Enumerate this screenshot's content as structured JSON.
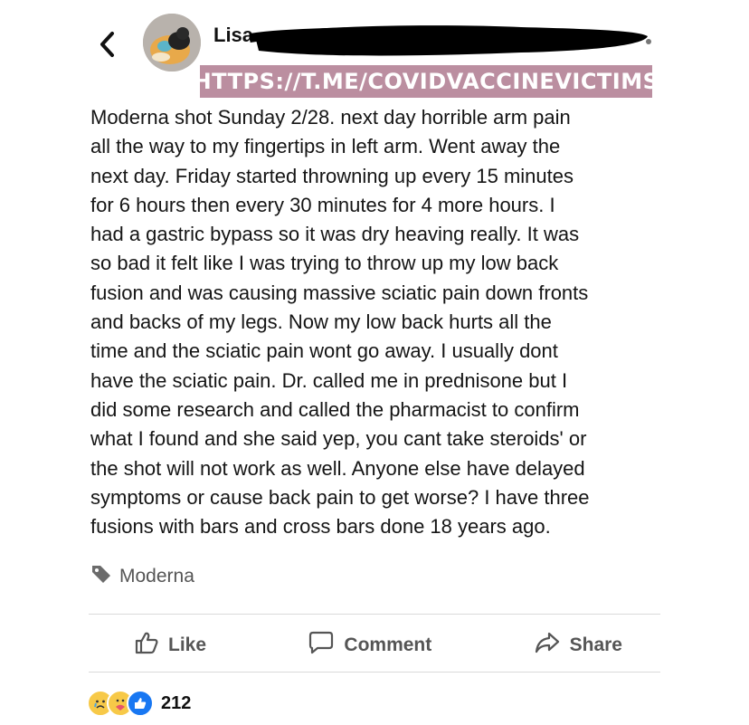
{
  "header": {
    "username": "Lisa",
    "watermark": "HTTPS://T.ME/COVIDVACCINEVICTIMS"
  },
  "post": {
    "lines": [
      "Moderna shot Sunday 2/28. next day horrible arm pain",
      "all the way to my fingertips in left arm. Went away the",
      "next day. Friday started throwning up every 15 minutes",
      "for 6 hours then every 30 minutes for 4 more hours. I",
      "had a gastric bypass so it was dry heaving really. It was",
      "so bad it felt like I was trying to throw up my low back",
      "fusion and was causing massive sciatic pain down fronts",
      "and backs of my legs. Now my low back hurts all the",
      "time and the sciatic pain wont go away. I usually dont",
      "have the sciatic pain. Dr. called me in prednisone but I",
      "did some research and called the pharmacist to confirm",
      "what I found and she said yep, you cant take steroids' or",
      "the shot will not work as well. Anyone else have delayed",
      "symptoms or cause back pain to get worse? I have three",
      "fusions with bars and cross bars done 18 years ago."
    ],
    "tag": "Moderna"
  },
  "actions": {
    "like": "Like",
    "comment": "Comment",
    "share": "Share"
  },
  "reactions": {
    "count": "212",
    "icons": [
      "sad-face-icon",
      "care-hug-icon",
      "like-thumb-icon"
    ]
  },
  "colors": {
    "watermark_bg": "#bb8ea0",
    "like_blue": "#1877f2",
    "icon_gray": "#555555"
  }
}
